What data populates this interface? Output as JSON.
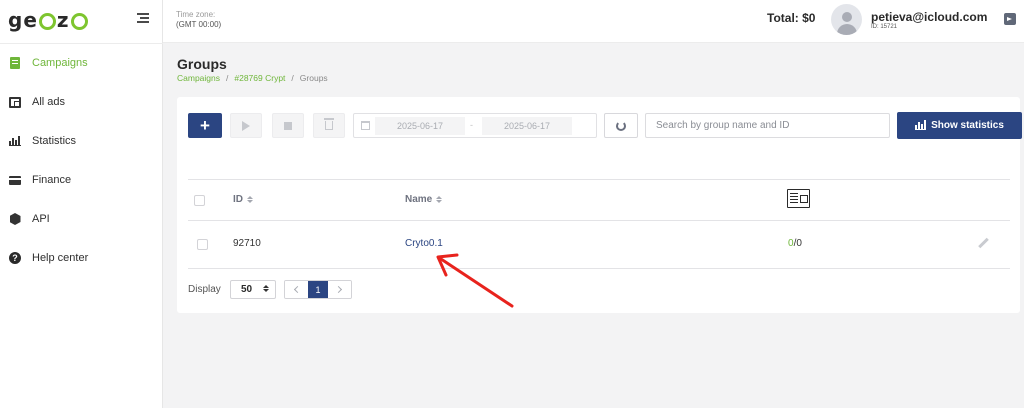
{
  "brand": {
    "logo_text": "geozo"
  },
  "sidebar": {
    "items": [
      {
        "label": "Campaigns",
        "icon": "campaigns-sheet-icon",
        "active": true
      },
      {
        "label": "All ads",
        "icon": "ads-icon"
      },
      {
        "label": "Statistics",
        "icon": "bar-chart-icon"
      },
      {
        "label": "Finance",
        "icon": "credit-card-icon"
      },
      {
        "label": "API",
        "icon": "api-hexagon-icon"
      },
      {
        "label": "Help center",
        "icon": "help-icon",
        "icon_glyph": "?"
      }
    ]
  },
  "header": {
    "timezone_label": "Time zone:",
    "timezone_value": "(GMT 00:00)",
    "total": "Total: $0",
    "user_email": "petieva@icloud.com",
    "user_id": "ID: 15721"
  },
  "page": {
    "title": "Groups",
    "breadcrumb": {
      "level1": "Campaigns",
      "sep": "/",
      "level2": "#28769 Crypt",
      "level3": "Groups"
    }
  },
  "toolbar": {
    "add_label": "+",
    "date_from": "2025-06-17",
    "date_separator": "-",
    "date_to": "2025-06-17",
    "search_placeholder": "Search by group name and ID",
    "stats_button": "Show statistics"
  },
  "table": {
    "columns": {
      "id": "ID",
      "name": "Name"
    },
    "rows": [
      {
        "id": "92710",
        "name": "Cryto0.1",
        "stat_active": "0",
        "stat_rest": "/0"
      }
    ]
  },
  "pagination": {
    "display_label": "Display",
    "page_size": "50",
    "current_page": "1"
  },
  "colors": {
    "accent_green": "#6fb63a",
    "primary_navy": "#2b4582",
    "annotation_red": "#e8231d"
  }
}
